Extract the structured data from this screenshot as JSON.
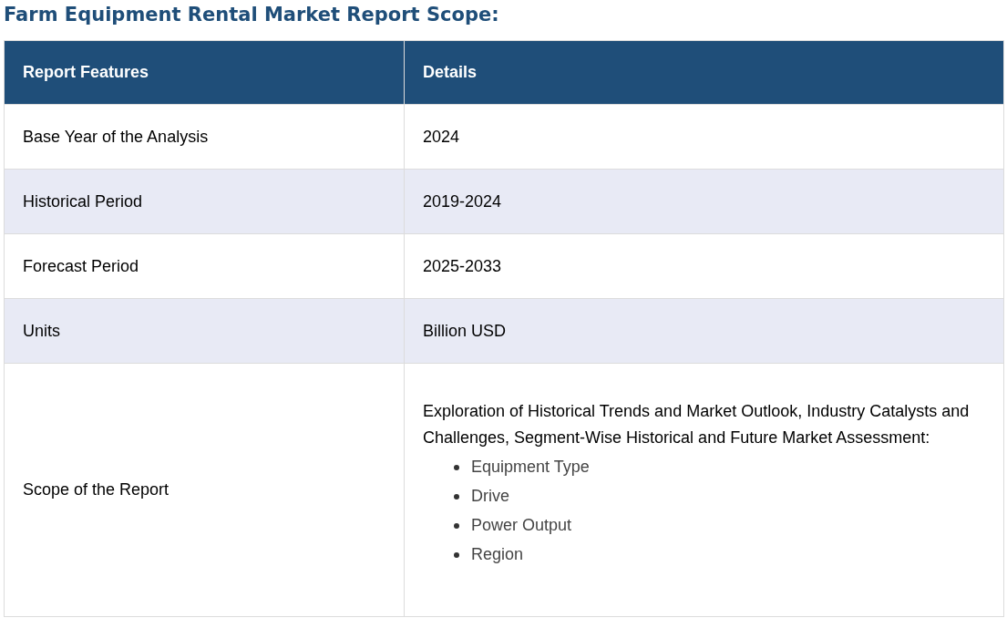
{
  "title": "Farm Equipment Rental Market Report Scope:",
  "table": {
    "columns": [
      "Report Features",
      "Details"
    ],
    "rows": [
      {
        "feature": "Base Year of the Analysis",
        "details": "2024"
      },
      {
        "feature": "Historical Period",
        "details": "2019-2024"
      },
      {
        "feature": "Forecast Period",
        "details": "2025-2033"
      },
      {
        "feature": "Units",
        "details": "Billion USD"
      },
      {
        "feature": "Scope of the Report",
        "details": "Exploration of Historical Trends and Market Outlook, Industry Catalysts and Challenges, Segment-Wise Historical and Future Market Assessment:",
        "bullets": [
          "Equipment Type",
          "Drive",
          "Power Output",
          "Region"
        ]
      }
    ]
  }
}
